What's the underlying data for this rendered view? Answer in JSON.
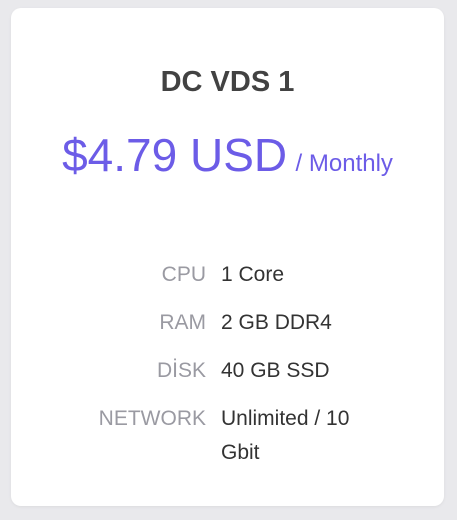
{
  "plan": {
    "title": "DC VDS 1",
    "price": "$4.79 USD",
    "period": "/ Monthly"
  },
  "specs": [
    {
      "label": "CPU",
      "value": "1 Core"
    },
    {
      "label": "RAM",
      "value": "2 GB DDR4"
    },
    {
      "label": "DİSK",
      "value": "40 GB SSD"
    },
    {
      "label": "NETWORK",
      "value": "Unlimited / 10 Gbit"
    }
  ],
  "colors": {
    "accent": "#6c5ce7",
    "title": "#424242",
    "label": "#9a9aa2",
    "value": "#333333",
    "background": "#e9e9ec"
  }
}
